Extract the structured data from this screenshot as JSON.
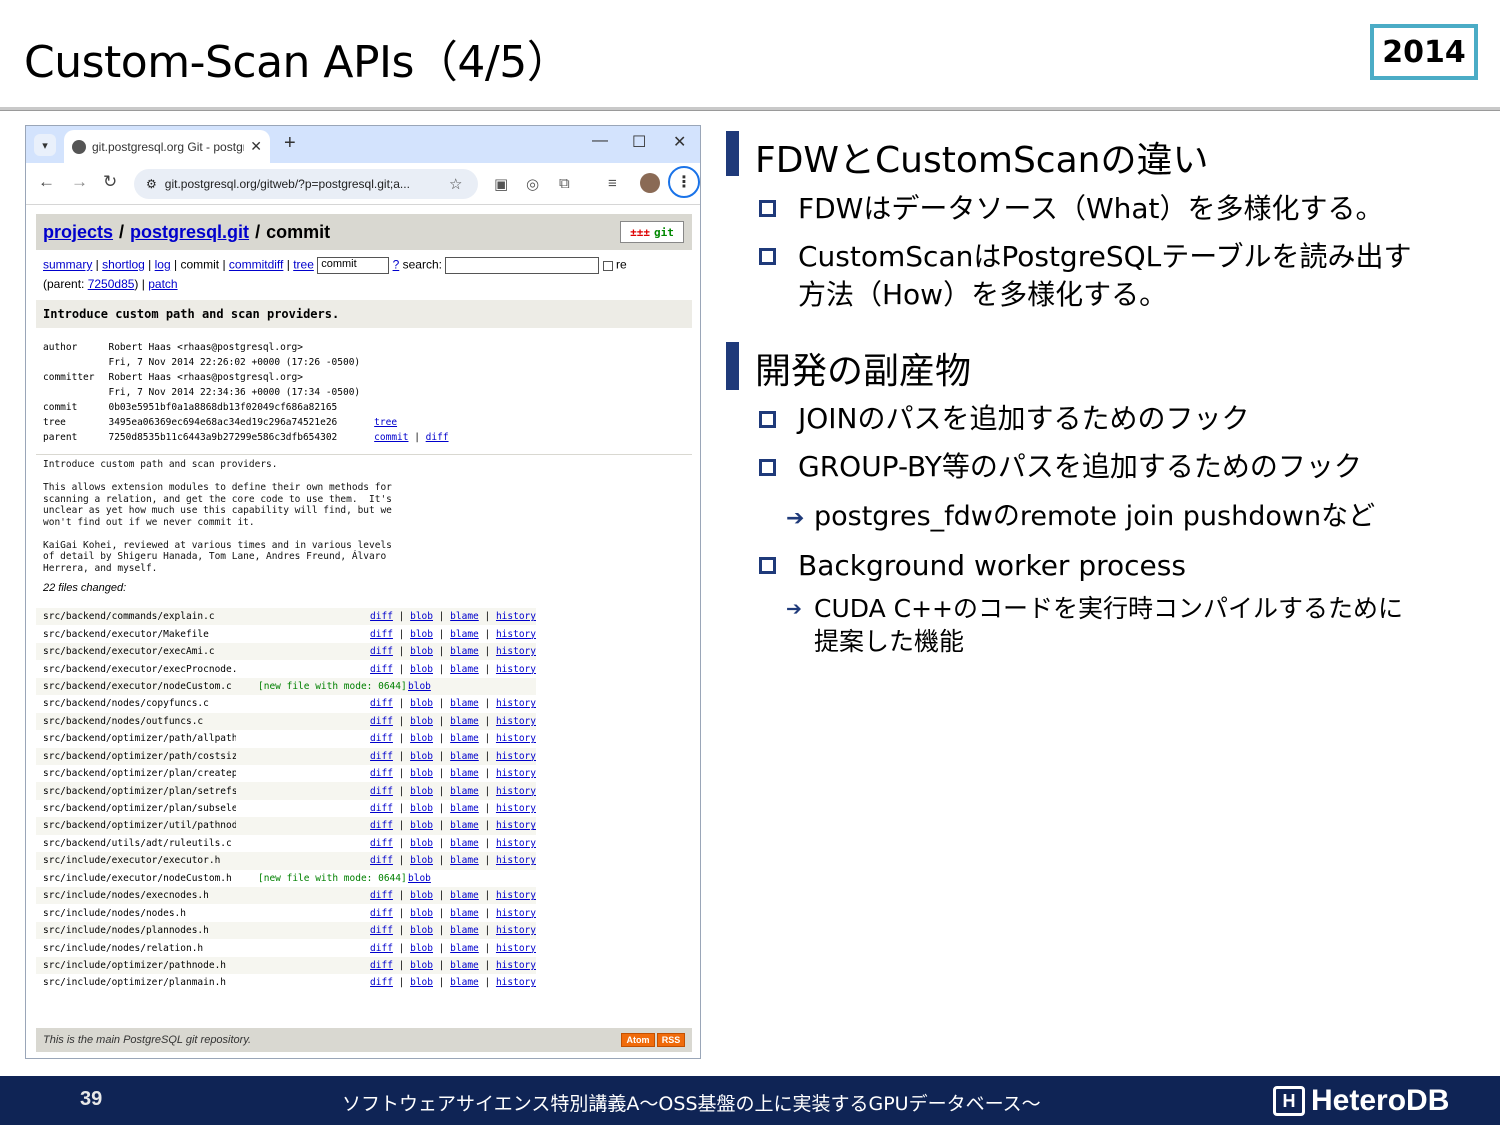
{
  "slide": {
    "title": "Custom-Scan APIs（4/5）",
    "year": "2014",
    "page_number": "39",
    "footer_text": "ソフトウェアサイエンス特別講義A～OSS基盤の上に実装するGPUデータベース～",
    "brand": "HeteroDB"
  },
  "browser": {
    "tab_title": "git.postgresql.org Git - postgresql",
    "url": "git.postgresql.org/gitweb/?p=postgresql.git;a..."
  },
  "gitweb": {
    "crumb_projects": "projects",
    "crumb_repo": "postgresql.git",
    "crumb_sep": "/",
    "crumb_page": "commit",
    "git_logo": "git",
    "nav": {
      "summary": "summary",
      "shortlog": "shortlog",
      "log": "log",
      "commit": "commit",
      "commitdiff": "commitdiff",
      "tree": "tree",
      "select_value": "commit",
      "help": "?",
      "search_label": "search:",
      "re_label": "re"
    },
    "parent_label": "(parent:",
    "parent_hash": "7250d85",
    "parent_close": ")",
    "patch": "patch",
    "subject": "Introduce custom path and scan providers.",
    "meta": {
      "author_label": "author",
      "author": "Robert Haas <rhaas@postgresql.org>",
      "author_date": "Fri, 7 Nov 2014 22:26:02 +0000 (17:26 -0500)",
      "committer_label": "committer",
      "committer": "Robert Haas <rhaas@postgresql.org>",
      "committer_date": "Fri, 7 Nov 2014 22:34:36 +0000 (17:34 -0500)",
      "commit_label": "commit",
      "commit_hash": "0b03e5951bf0a1a8868db13f02049cf686a82165",
      "tree_label": "tree",
      "tree_hash": "3495ea06369ec694e68ac34ed19c296a74521e26",
      "tree_link": "tree",
      "parent_label": "parent",
      "parent_hash": "7250d8535b11c6443a9b27299e586c3dfb654302",
      "parent_commit_link": "commit",
      "parent_diff_link": "diff"
    },
    "message": "Introduce custom path and scan providers.\n\nThis allows extension modules to define their own methods for\nscanning a relation, and get the core code to use them.  It's\nunclear as yet how much use this capability will find, but we\nwon't find out if we never commit it.\n\nKaiGai Kohei, reviewed at various times and in various levels\nof detail by Shigeru Hanada, Tom Lane, Andres Freund, Álvaro\nHerrera, and myself.",
    "files_changed": "22 files changed:",
    "link_diff": "diff",
    "link_blob": "blob",
    "link_blame": "blame",
    "link_history": "history",
    "files": [
      {
        "path": "src/backend/commands/explain.c",
        "status": "",
        "new": false
      },
      {
        "path": "src/backend/executor/Makefile",
        "status": "",
        "new": false
      },
      {
        "path": "src/backend/executor/execAmi.c",
        "status": "",
        "new": false
      },
      {
        "path": "src/backend/executor/execProcnode.c",
        "status": "",
        "new": false
      },
      {
        "path": "src/backend/executor/nodeCustom.c",
        "status": "[new file with mode: 0644]",
        "new": true
      },
      {
        "path": "src/backend/nodes/copyfuncs.c",
        "status": "",
        "new": false
      },
      {
        "path": "src/backend/nodes/outfuncs.c",
        "status": "",
        "new": false
      },
      {
        "path": "src/backend/optimizer/path/allpaths.c",
        "status": "",
        "new": false
      },
      {
        "path": "src/backend/optimizer/path/costsize.c",
        "status": "",
        "new": false
      },
      {
        "path": "src/backend/optimizer/plan/createplan.c",
        "status": "",
        "new": false
      },
      {
        "path": "src/backend/optimizer/plan/setrefs.c",
        "status": "",
        "new": false
      },
      {
        "path": "src/backend/optimizer/plan/subselect.c",
        "status": "",
        "new": false
      },
      {
        "path": "src/backend/optimizer/util/pathnode.c",
        "status": "",
        "new": false
      },
      {
        "path": "src/backend/utils/adt/ruleutils.c",
        "status": "",
        "new": false
      },
      {
        "path": "src/include/executor/executor.h",
        "status": "",
        "new": false
      },
      {
        "path": "src/include/executor/nodeCustom.h",
        "status": "[new file with mode: 0644]",
        "new": true
      },
      {
        "path": "src/include/nodes/execnodes.h",
        "status": "",
        "new": false
      },
      {
        "path": "src/include/nodes/nodes.h",
        "status": "",
        "new": false
      },
      {
        "path": "src/include/nodes/plannodes.h",
        "status": "",
        "new": false
      },
      {
        "path": "src/include/nodes/relation.h",
        "status": "",
        "new": false
      },
      {
        "path": "src/include/optimizer/pathnode.h",
        "status": "",
        "new": false
      },
      {
        "path": "src/include/optimizer/planmain.h",
        "status": "",
        "new": false
      }
    ],
    "footer": "This is the main PostgreSQL git repository.",
    "atom": "Atom",
    "rss": "RSS"
  },
  "content": {
    "heading1": "FDWとCustomScanの違い",
    "bullet1": "FDWはデータソース（What）を多様化する。",
    "bullet2_line1": "CustomScanはPostgreSQLテーブルを読み出す",
    "bullet2_line2": "方法（How）を多様化する。",
    "heading2": "開発の副産物",
    "bullet3": "JOINのパスを追加するためのフック",
    "bullet4": "GROUP-BY等のパスを追加するためのフック",
    "sub1": "postgres_fdwのremote join pushdownなど",
    "bullet5": "Background worker process",
    "sub2_line1": "CUDA C++のコードを実行時コンパイルするために",
    "sub2_line2": "提案した機能"
  }
}
